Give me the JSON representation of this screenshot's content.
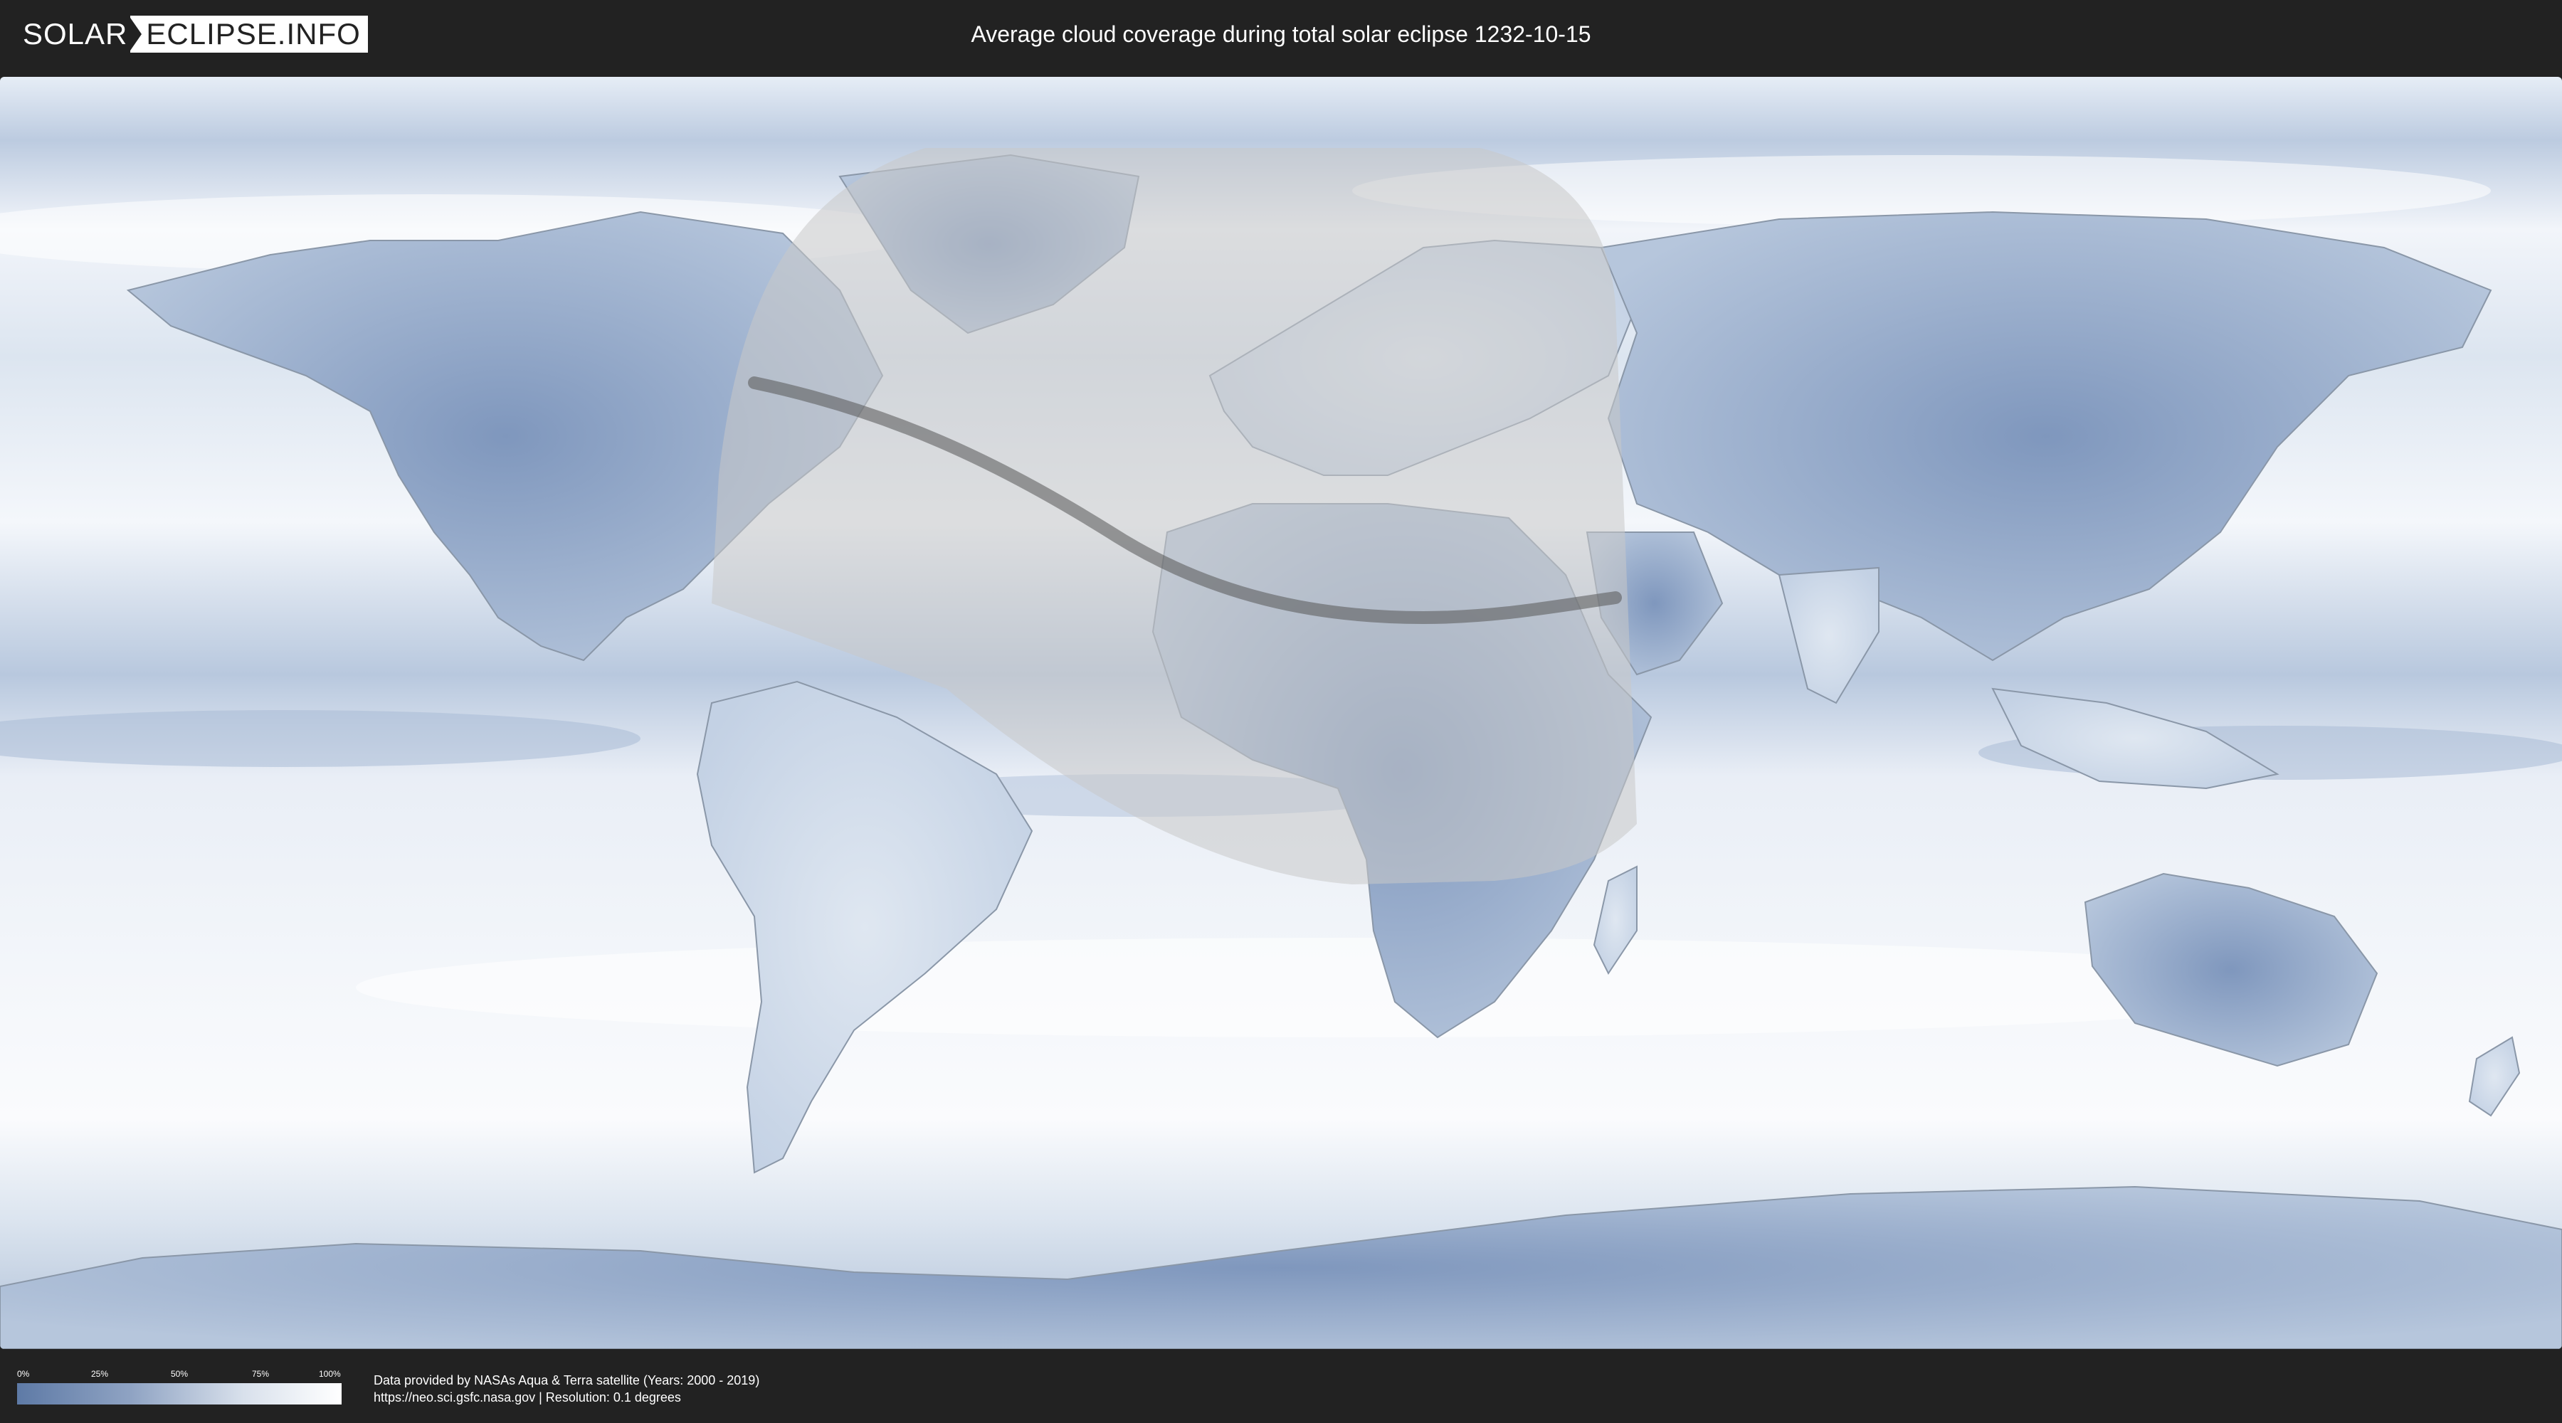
{
  "header": {
    "logo": {
      "part1": "SOLAR",
      "part2": "ECLIPSE.INFO"
    },
    "title": "Average cloud coverage during total solar eclipse 1232-10-15"
  },
  "map": {
    "colors": {
      "clear_sky": "#5e7aa6",
      "cloudy": "#ffffff",
      "penumbra_overlay": "#c8c8c8",
      "totality_path": "#555555",
      "coastline": "#8a97a8"
    }
  },
  "legend": {
    "ticks": [
      "0%",
      "25%",
      "50%",
      "75%",
      "100%"
    ]
  },
  "footer": {
    "credit_line1": "Data provided by NASAs Aqua & Terra satellite (Years: 2000 - 2019)",
    "credit_line2": "https://neo.sci.gsfc.nasa.gov | Resolution: 0.1 degrees"
  }
}
